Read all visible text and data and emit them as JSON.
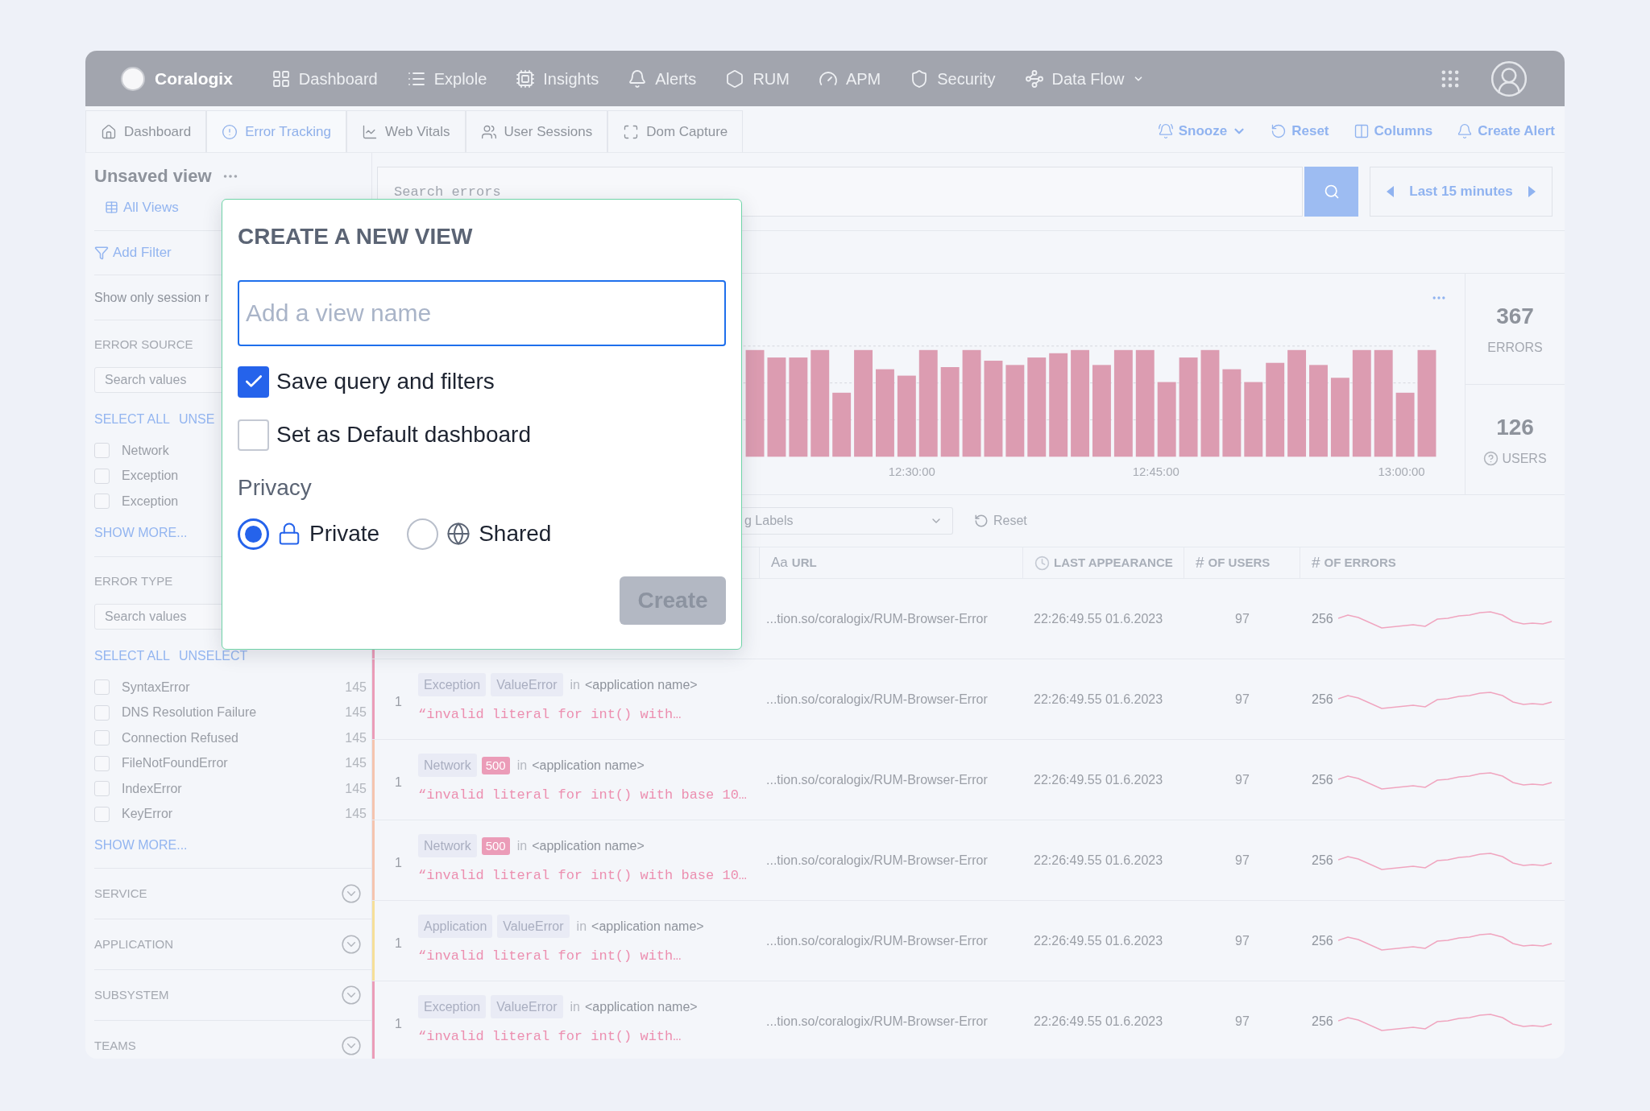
{
  "nav": {
    "brand": "Coralogix",
    "items": [
      {
        "label": "Dashboard",
        "kind": "grid",
        "dropdown": false
      },
      {
        "label": "Explole",
        "kind": "list",
        "dropdown": false
      },
      {
        "label": "Insights",
        "kind": "chip",
        "dropdown": false
      },
      {
        "label": "Alerts",
        "kind": "bell",
        "dropdown": false
      },
      {
        "label": "RUM",
        "kind": "hexagon",
        "dropdown": false
      },
      {
        "label": "APM",
        "kind": "gauge",
        "dropdown": false
      },
      {
        "label": "Security",
        "kind": "shield",
        "dropdown": false
      },
      {
        "label": "Data Flow",
        "kind": "flow",
        "dropdown": true
      }
    ]
  },
  "subnav": {
    "tabs": [
      {
        "label": "Dashboard",
        "kind": "home",
        "selected": false
      },
      {
        "label": "Error Tracking",
        "kind": "alert",
        "selected": true
      },
      {
        "label": "Web Vitals",
        "kind": "chart",
        "selected": false
      },
      {
        "label": "User Sessions",
        "kind": "users",
        "selected": false
      },
      {
        "label": "Dom Capture",
        "kind": "capture",
        "selected": false
      }
    ],
    "actions": [
      {
        "label": "Snooze",
        "kind": "snooze"
      },
      {
        "label": "Reset",
        "kind": "reset"
      },
      {
        "label": "Columns",
        "kind": "columns"
      },
      {
        "label": "Create Alert",
        "kind": "alert"
      }
    ]
  },
  "sidebar": {
    "view_title": "Unsaved view",
    "all_views": "All Views",
    "add_filter": "Add Filter",
    "session_toggle": "Show only session r",
    "error_source": {
      "title": "ERROR SOURCE",
      "search_placeholder": "Search values",
      "select_all": "SELECT ALL",
      "unselect": "UNSE",
      "show_more": "SHOW MORE...",
      "options": [
        {
          "label": "Network",
          "checked": false
        },
        {
          "label": "Exception",
          "checked": false
        },
        {
          "label": "Exception",
          "checked": false
        }
      ]
    },
    "error_type": {
      "title": "ERROR TYPE",
      "search_placeholder": "Search values",
      "select_all": "SELECT ALL",
      "unselect": "UNSELECT",
      "show_more": "SHOW MORE...",
      "options": [
        {
          "label": "SyntaxError",
          "count": "145",
          "checked": false
        },
        {
          "label": "DNS Resolution Failure",
          "count": "145",
          "checked": false
        },
        {
          "label": "Connection Refused",
          "count": "145",
          "checked": false
        },
        {
          "label": "FileNotFoundError",
          "count": "145",
          "checked": false
        },
        {
          "label": "IndexError",
          "count": "145",
          "checked": false
        },
        {
          "label": "KeyError",
          "count": "145",
          "checked": false
        }
      ]
    },
    "sections": [
      "SERVICE",
      "APPLICATION",
      "SUBSYSTEM",
      "TEAMS"
    ]
  },
  "search": {
    "placeholder": "Search errors"
  },
  "time_range": "Last 15 minutes",
  "chart": {
    "x_labels": [
      "12:30:00",
      "12:45:00",
      "13:00:00"
    ]
  },
  "stats": [
    {
      "value": "367",
      "label": "ERRORS",
      "help": false
    },
    {
      "value": "126",
      "label": "USERS",
      "help": true
    }
  ],
  "filters": {
    "labels_dropdown": "g Labels",
    "reset": "Reset"
  },
  "table": {
    "columns": [
      {
        "label": "URL",
        "symbol": "Aa",
        "kind": "text"
      },
      {
        "label": "LAST APPEARANCE",
        "kind": "time"
      },
      {
        "label": "OF USERS",
        "symbol": "#",
        "kind": "number"
      },
      {
        "label": "OF ERRORS",
        "symbol": "#",
        "kind": "number"
      }
    ],
    "rows": [
      {
        "color": "#eb9cb8",
        "url": "...tion.so/coralogix/RUM-Browser-Error",
        "last": "22:26:49.55 01.6.2023",
        "users": "97",
        "errors": "256"
      },
      {
        "color": "#eb9cb8",
        "count": "1",
        "tags": [
          {
            "label": "Exception",
            "kind": "tag"
          },
          {
            "label": "ValueError",
            "kind": "tag"
          }
        ],
        "in": "in",
        "app": "<application name>",
        "message": "“invalid literal for int() with…",
        "url": "...tion.so/coralogix/RUM-Browser-Error",
        "last": "22:26:49.55 01.6.2023",
        "users": "97",
        "errors": "256"
      },
      {
        "color": "#f5c4ae",
        "count": "1",
        "tags": [
          {
            "label": "Network",
            "kind": "tag"
          },
          {
            "label": "500",
            "kind": "status"
          }
        ],
        "in": "in",
        "app": "<application name>",
        "message": "“invalid literal for int() with base 10…",
        "url": "...tion.so/coralogix/RUM-Browser-Error",
        "last": "22:26:49.55 01.6.2023",
        "users": "97",
        "errors": "256"
      },
      {
        "color": "#f5c4ae",
        "count": "1",
        "tags": [
          {
            "label": "Network",
            "kind": "tag"
          },
          {
            "label": "500",
            "kind": "status"
          }
        ],
        "in": "in",
        "app": "<application name>",
        "message": "“invalid literal for int() with base 10…",
        "url": "...tion.so/coralogix/RUM-Browser-Error",
        "last": "22:26:49.55 01.6.2023",
        "users": "97",
        "errors": "256"
      },
      {
        "color": "#f6df98",
        "count": "1",
        "tags": [
          {
            "label": "Application",
            "kind": "tag"
          },
          {
            "label": "ValueError",
            "kind": "tag"
          }
        ],
        "in": "in",
        "app": "<application name>",
        "message": "“invalid literal for int() with…",
        "url": "...tion.so/coralogix/RUM-Browser-Error",
        "last": "22:26:49.55 01.6.2023",
        "users": "97",
        "errors": "256"
      },
      {
        "color": "#eb9cb8",
        "count": "1",
        "tags": [
          {
            "label": "Exception",
            "kind": "tag"
          },
          {
            "label": "ValueError",
            "kind": "tag"
          }
        ],
        "in": "in",
        "app": "<application name>",
        "message": "“invalid literal for int() with…",
        "url": "...tion.so/coralogix/RUM-Browser-Error",
        "last": "22:26:49.55 01.6.2023",
        "users": "97",
        "errors": "256"
      }
    ]
  },
  "modal": {
    "title": "CREATE A NEW VIEW",
    "name_placeholder": "Add a view name",
    "options": [
      {
        "label": "Save query and filters",
        "checked": true
      },
      {
        "label": "Set as Default dashboard",
        "checked": false
      }
    ],
    "privacy_label": "Privacy",
    "privacy": [
      {
        "label": "Private",
        "kind": "lock",
        "selected": true
      },
      {
        "label": "Shared",
        "kind": "globe",
        "selected": false
      }
    ],
    "create": {
      "label": "Create",
      "disabled": true
    }
  }
}
